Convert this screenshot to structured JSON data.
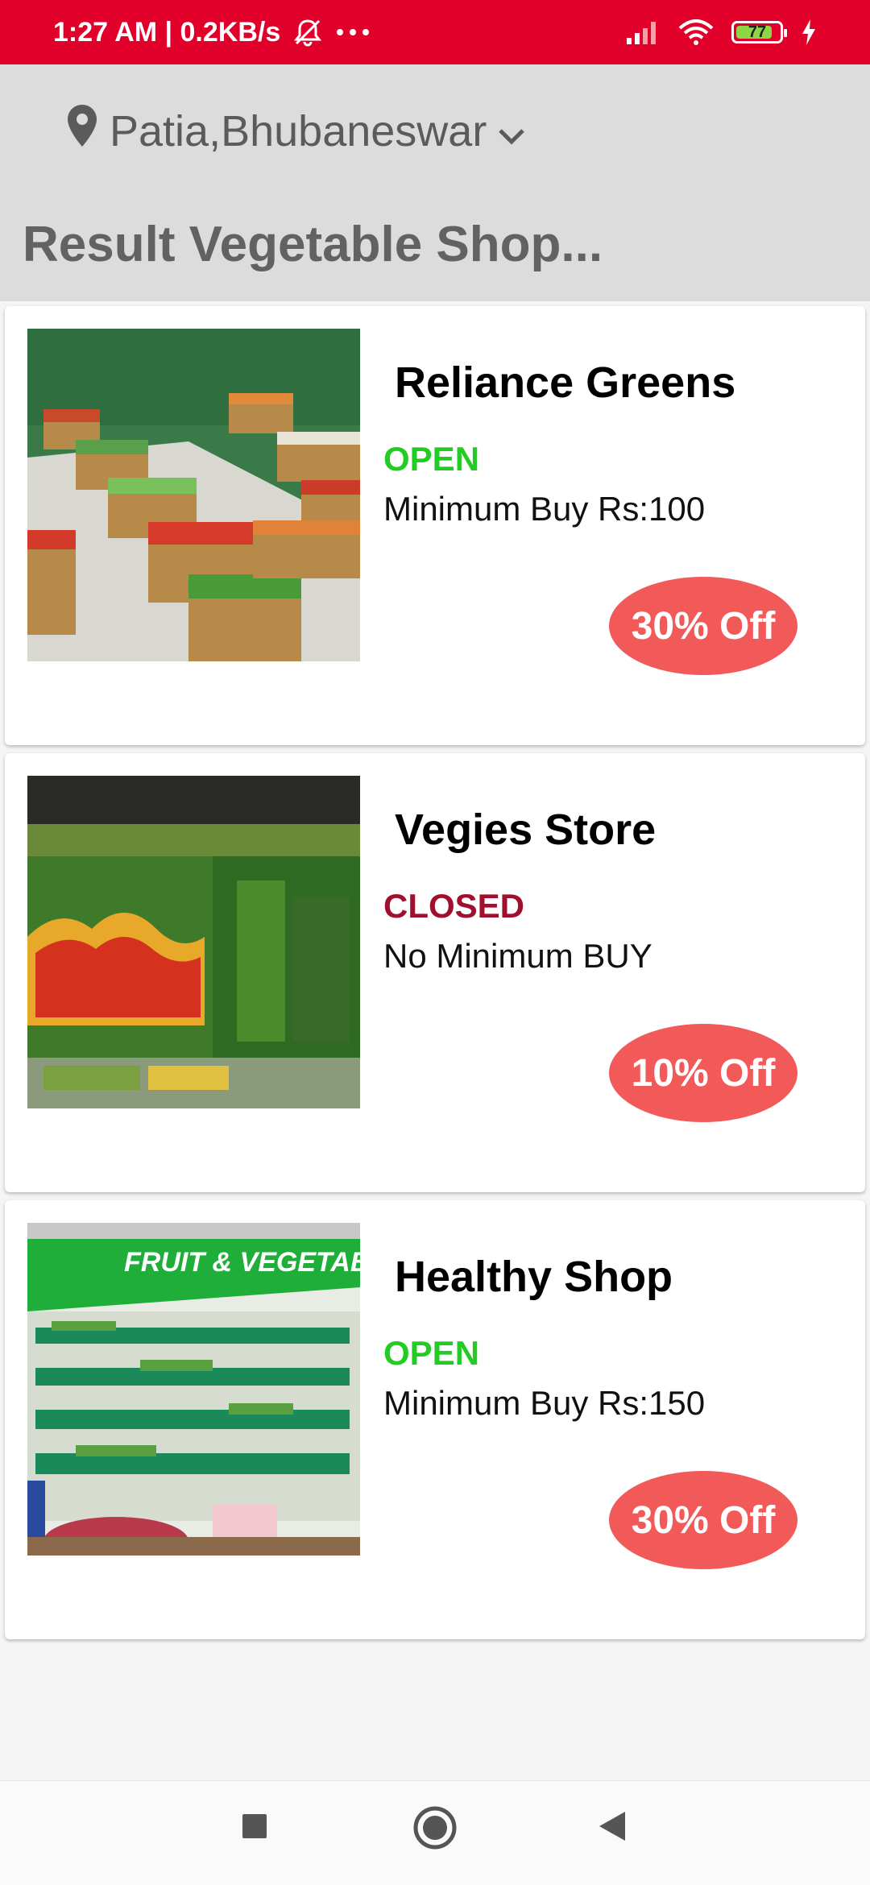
{
  "status_bar": {
    "time_speed": "1:27 AM | 0.2KB/s",
    "battery_level": "77",
    "icons": [
      "mute-icon",
      "more-icon",
      "signal-icon",
      "wifi-icon",
      "battery-icon",
      "charging-icon"
    ]
  },
  "header": {
    "location": "Patia,Bhubaneswar",
    "title": "Result Vegetable Shop..."
  },
  "shops": [
    {
      "name": "Reliance Greens",
      "status": "OPEN",
      "status_color": "#22cc22",
      "min_buy": "Minimum Buy Rs:100",
      "discount": "30% Off",
      "image": "store-aisle-image"
    },
    {
      "name": "Vegies Store",
      "status": "CLOSED",
      "status_color": "#a0102e",
      "min_buy": "No Minimum BUY",
      "discount": "10% Off",
      "image": "produce-shelf-image"
    },
    {
      "name": "Healthy Shop",
      "status": "OPEN",
      "status_color": "#22cc22",
      "min_buy": "Minimum Buy Rs:150",
      "discount": "30% Off",
      "image": "fruit-vegetables-store-image",
      "image_sign_text": "FRUIT & VEGETABLES"
    }
  ],
  "colors": {
    "status_bar": "#e0002a",
    "discount_badge": "#f25a5a",
    "header_bg": "#dcdcdc"
  },
  "navbar": {
    "icons": [
      "recents-square-icon",
      "home-circle-icon",
      "back-triangle-icon"
    ]
  }
}
